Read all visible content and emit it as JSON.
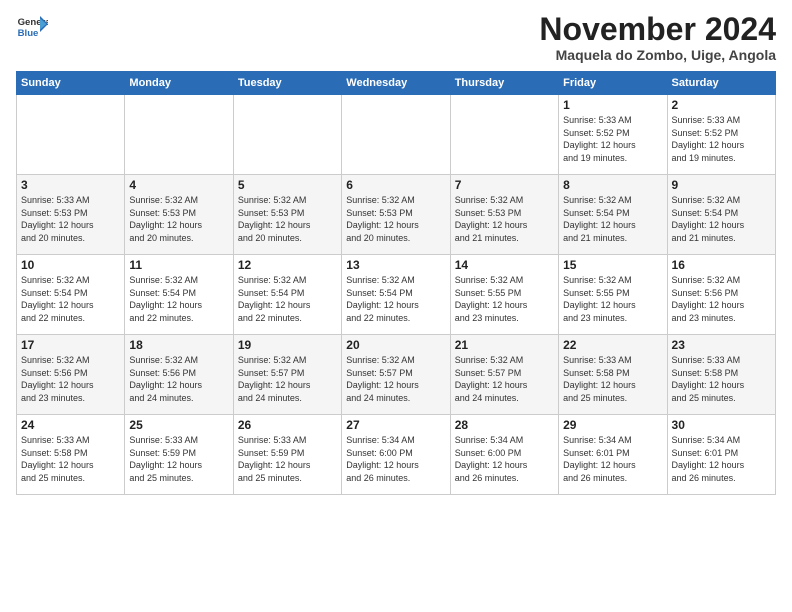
{
  "logo": {
    "line1": "General",
    "line2": "Blue"
  },
  "header": {
    "month": "November 2024",
    "location": "Maquela do Zombo, Uige, Angola"
  },
  "days_of_week": [
    "Sunday",
    "Monday",
    "Tuesday",
    "Wednesday",
    "Thursday",
    "Friday",
    "Saturday"
  ],
  "weeks": [
    [
      {
        "day": "",
        "info": ""
      },
      {
        "day": "",
        "info": ""
      },
      {
        "day": "",
        "info": ""
      },
      {
        "day": "",
        "info": ""
      },
      {
        "day": "",
        "info": ""
      },
      {
        "day": "1",
        "info": "Sunrise: 5:33 AM\nSunset: 5:52 PM\nDaylight: 12 hours\nand 19 minutes."
      },
      {
        "day": "2",
        "info": "Sunrise: 5:33 AM\nSunset: 5:52 PM\nDaylight: 12 hours\nand 19 minutes."
      }
    ],
    [
      {
        "day": "3",
        "info": "Sunrise: 5:33 AM\nSunset: 5:53 PM\nDaylight: 12 hours\nand 20 minutes."
      },
      {
        "day": "4",
        "info": "Sunrise: 5:32 AM\nSunset: 5:53 PM\nDaylight: 12 hours\nand 20 minutes."
      },
      {
        "day": "5",
        "info": "Sunrise: 5:32 AM\nSunset: 5:53 PM\nDaylight: 12 hours\nand 20 minutes."
      },
      {
        "day": "6",
        "info": "Sunrise: 5:32 AM\nSunset: 5:53 PM\nDaylight: 12 hours\nand 20 minutes."
      },
      {
        "day": "7",
        "info": "Sunrise: 5:32 AM\nSunset: 5:53 PM\nDaylight: 12 hours\nand 21 minutes."
      },
      {
        "day": "8",
        "info": "Sunrise: 5:32 AM\nSunset: 5:54 PM\nDaylight: 12 hours\nand 21 minutes."
      },
      {
        "day": "9",
        "info": "Sunrise: 5:32 AM\nSunset: 5:54 PM\nDaylight: 12 hours\nand 21 minutes."
      }
    ],
    [
      {
        "day": "10",
        "info": "Sunrise: 5:32 AM\nSunset: 5:54 PM\nDaylight: 12 hours\nand 22 minutes."
      },
      {
        "day": "11",
        "info": "Sunrise: 5:32 AM\nSunset: 5:54 PM\nDaylight: 12 hours\nand 22 minutes."
      },
      {
        "day": "12",
        "info": "Sunrise: 5:32 AM\nSunset: 5:54 PM\nDaylight: 12 hours\nand 22 minutes."
      },
      {
        "day": "13",
        "info": "Sunrise: 5:32 AM\nSunset: 5:54 PM\nDaylight: 12 hours\nand 22 minutes."
      },
      {
        "day": "14",
        "info": "Sunrise: 5:32 AM\nSunset: 5:55 PM\nDaylight: 12 hours\nand 23 minutes."
      },
      {
        "day": "15",
        "info": "Sunrise: 5:32 AM\nSunset: 5:55 PM\nDaylight: 12 hours\nand 23 minutes."
      },
      {
        "day": "16",
        "info": "Sunrise: 5:32 AM\nSunset: 5:56 PM\nDaylight: 12 hours\nand 23 minutes."
      }
    ],
    [
      {
        "day": "17",
        "info": "Sunrise: 5:32 AM\nSunset: 5:56 PM\nDaylight: 12 hours\nand 23 minutes."
      },
      {
        "day": "18",
        "info": "Sunrise: 5:32 AM\nSunset: 5:56 PM\nDaylight: 12 hours\nand 24 minutes."
      },
      {
        "day": "19",
        "info": "Sunrise: 5:32 AM\nSunset: 5:57 PM\nDaylight: 12 hours\nand 24 minutes."
      },
      {
        "day": "20",
        "info": "Sunrise: 5:32 AM\nSunset: 5:57 PM\nDaylight: 12 hours\nand 24 minutes."
      },
      {
        "day": "21",
        "info": "Sunrise: 5:32 AM\nSunset: 5:57 PM\nDaylight: 12 hours\nand 24 minutes."
      },
      {
        "day": "22",
        "info": "Sunrise: 5:33 AM\nSunset: 5:58 PM\nDaylight: 12 hours\nand 25 minutes."
      },
      {
        "day": "23",
        "info": "Sunrise: 5:33 AM\nSunset: 5:58 PM\nDaylight: 12 hours\nand 25 minutes."
      }
    ],
    [
      {
        "day": "24",
        "info": "Sunrise: 5:33 AM\nSunset: 5:58 PM\nDaylight: 12 hours\nand 25 minutes."
      },
      {
        "day": "25",
        "info": "Sunrise: 5:33 AM\nSunset: 5:59 PM\nDaylight: 12 hours\nand 25 minutes."
      },
      {
        "day": "26",
        "info": "Sunrise: 5:33 AM\nSunset: 5:59 PM\nDaylight: 12 hours\nand 25 minutes."
      },
      {
        "day": "27",
        "info": "Sunrise: 5:34 AM\nSunset: 6:00 PM\nDaylight: 12 hours\nand 26 minutes."
      },
      {
        "day": "28",
        "info": "Sunrise: 5:34 AM\nSunset: 6:00 PM\nDaylight: 12 hours\nand 26 minutes."
      },
      {
        "day": "29",
        "info": "Sunrise: 5:34 AM\nSunset: 6:01 PM\nDaylight: 12 hours\nand 26 minutes."
      },
      {
        "day": "30",
        "info": "Sunrise: 5:34 AM\nSunset: 6:01 PM\nDaylight: 12 hours\nand 26 minutes."
      }
    ]
  ]
}
